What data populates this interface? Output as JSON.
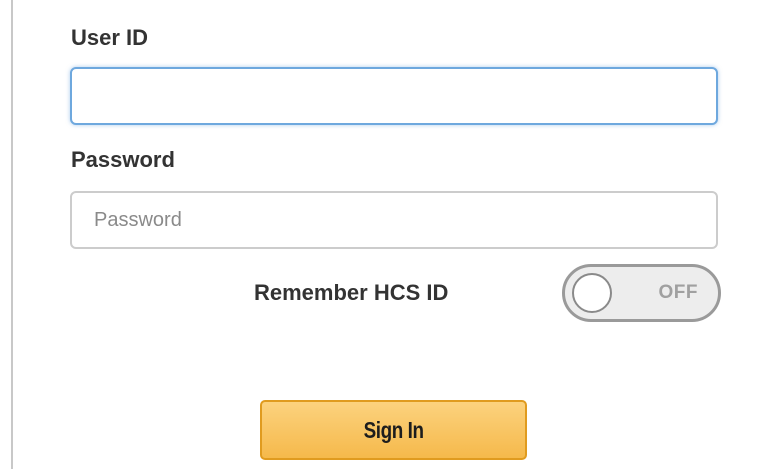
{
  "form": {
    "user_id_label": "User ID",
    "user_id_value": "",
    "user_id_placeholder": "",
    "password_label": "Password",
    "password_value": "",
    "password_placeholder": "Password",
    "remember_label": "Remember HCS ID",
    "remember_toggle": {
      "state_text": "OFF",
      "on": false
    },
    "sign_in_label": "Sign In"
  },
  "colors": {
    "focus_border": "#6ea8de",
    "input_border": "#cccccc",
    "button_fill": "#f5b94b",
    "button_border": "#e09b1f",
    "label_text": "#333333"
  }
}
